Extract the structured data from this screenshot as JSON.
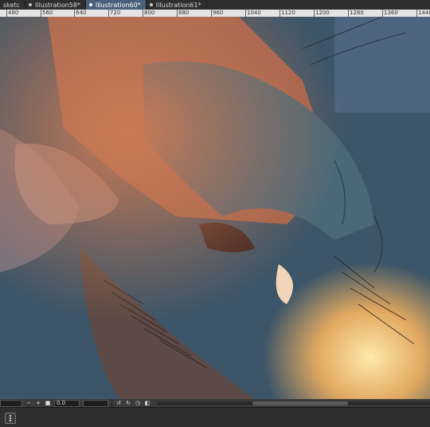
{
  "tabs": [
    {
      "label": "sketc"
    },
    {
      "label": "Illustration58*"
    },
    {
      "label": "Illustration60*"
    },
    {
      "label": "Illustration61*"
    }
  ],
  "ruler": {
    "ticks": [
      "480",
      "560",
      "640",
      "720",
      "800",
      "880",
      "960",
      "1040",
      "1120",
      "1200",
      "1280",
      "1360",
      "1440"
    ]
  },
  "bottom": {
    "zoom_value": "0.0",
    "minus": "−",
    "plus": "+"
  },
  "colors": {
    "accent": "#4a5f7a",
    "canvas_bg": "#3a5266"
  }
}
